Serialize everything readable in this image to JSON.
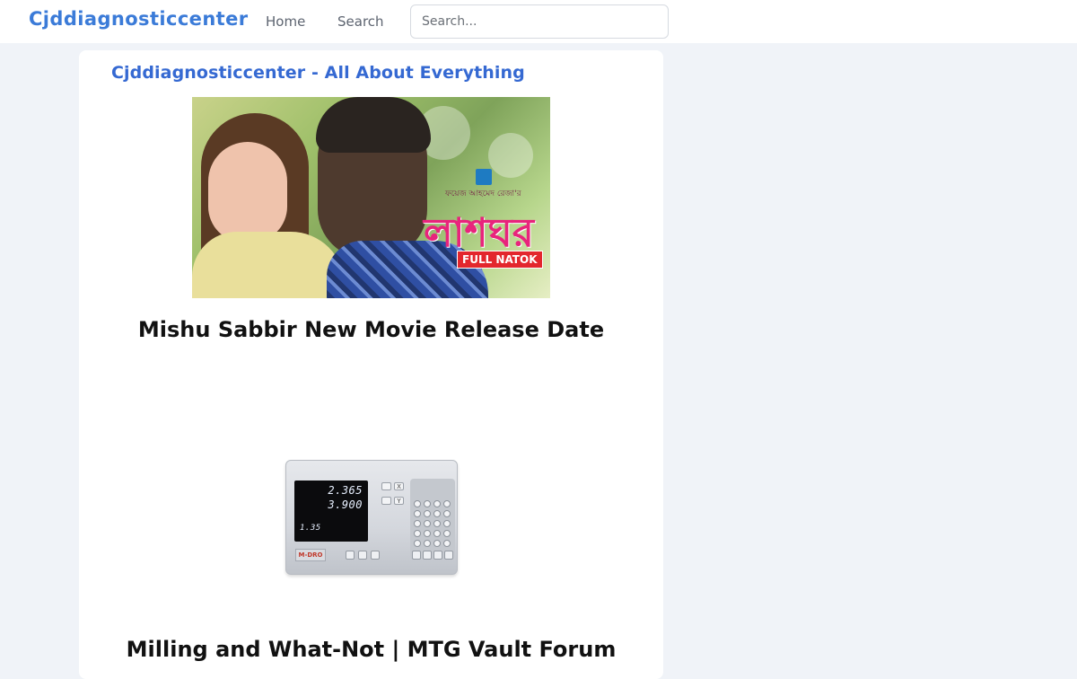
{
  "header": {
    "brand": "Cjddiagnosticcenter",
    "nav": [
      {
        "label": "Home"
      },
      {
        "label": "Search"
      }
    ],
    "search": {
      "placeholder": "Search...",
      "value": ""
    }
  },
  "main": {
    "site_title": "Cjddiagnosticcenter - All About Everything",
    "posts": [
      {
        "title": "Mishu Sabbir New Movie Release Date",
        "image": {
          "badge_text": "FULL NATOK",
          "title_text": "লাশঘর",
          "subtitle_text": "ফয়েজ আহমেদ রেজা'র"
        }
      },
      {
        "title": "Milling and What-Not | MTG Vault Forum",
        "image": {
          "readout_1": "2.365",
          "readout_2": "3.900",
          "readout_3": "1.35",
          "axis_x": "X",
          "axis_y": "Y",
          "brand_tag": "M-DRO"
        }
      }
    ]
  },
  "colors": {
    "brand": "#3b7bd8",
    "site_title": "#3569d2",
    "page_bg": "#f0f3f8",
    "card_bg": "#ffffff"
  }
}
